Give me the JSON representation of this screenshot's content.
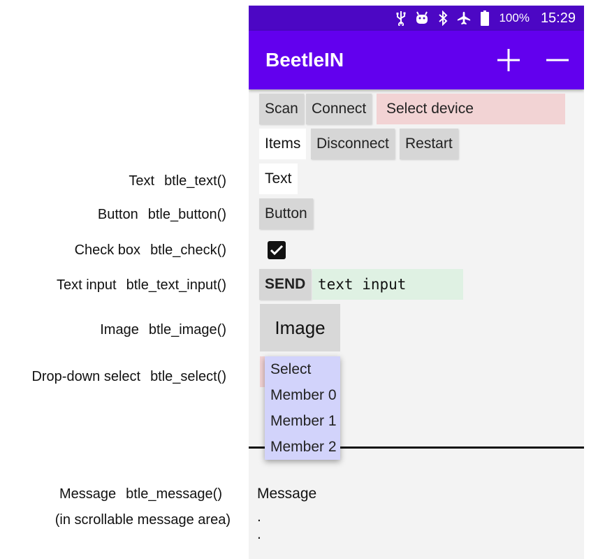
{
  "annotations": [
    {
      "name": "Text",
      "func": "btle_text()"
    },
    {
      "name": "Button",
      "func": "btle_button()"
    },
    {
      "name": "Check box",
      "func": "btle_check()"
    },
    {
      "name": "Text input",
      "func": "btle_text_input()"
    },
    {
      "name": "Image",
      "func": "btle_image()"
    },
    {
      "name": "Drop-down select",
      "func": "btle_select()"
    },
    {
      "name": "Message",
      "func": "btle_message()"
    }
  ],
  "annotation_note": "(in scrollable message area)",
  "statusbar": {
    "battery": "100%",
    "time": "15:29",
    "icons": [
      "usb-icon",
      "android-debug-icon",
      "bluetooth-icon",
      "airplane-icon",
      "battery-icon"
    ]
  },
  "appbar": {
    "title": "BeetleIN",
    "actions": [
      "plus-icon",
      "minus-icon"
    ]
  },
  "toolbar": {
    "scan": "Scan",
    "connect": "Connect",
    "select_device": "Select device",
    "items": "Items",
    "disconnect": "Disconnect",
    "restart": "Restart"
  },
  "widgets": {
    "text": "Text",
    "button": "Button",
    "checkbox_checked": true,
    "send": "SEND",
    "text_input": "text input",
    "image": "Image",
    "select_options": [
      "Select",
      "Member 0",
      "Member 1",
      "Member 2"
    ]
  },
  "messages": {
    "first": "Message",
    "dots": [
      ".",
      "."
    ]
  },
  "colors": {
    "statusbar": "#4c07c4",
    "appbar": "#6200ee",
    "button": "#d6d6d6",
    "select_device": "#f2d3d4",
    "text_input": "#dff1e3",
    "dropdown": "#d2d3fb"
  }
}
